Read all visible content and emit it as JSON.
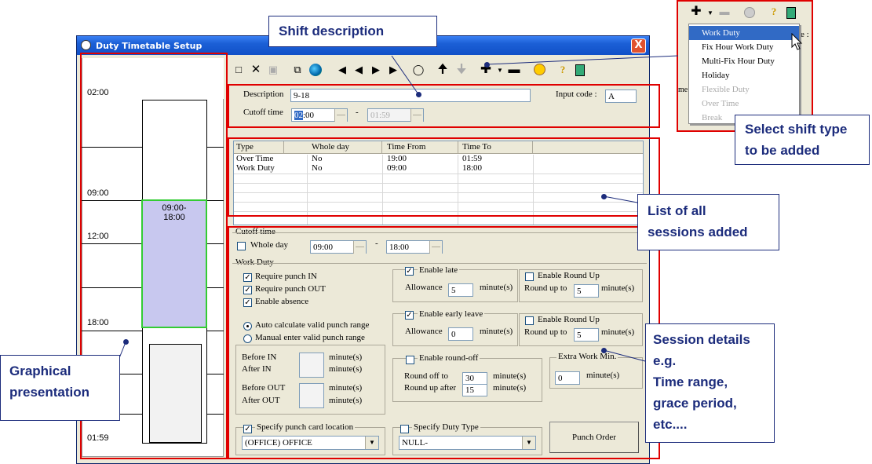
{
  "window": {
    "title": "Duty Timetable Setup",
    "close": "X"
  },
  "timeline": {
    "labels": [
      "02:00",
      "09:00",
      "12:00",
      "18:00",
      "01:59"
    ],
    "session_label": "09:00-\n18:00"
  },
  "header": {
    "description_label": "Description",
    "description_value": "9-18",
    "input_code_label": "Input code :",
    "input_code_value": "A",
    "cutoff_label": "Cutoff time",
    "cutoff_from_sel": "02",
    "cutoff_from_rest": ":00",
    "cutoff_dash": "-",
    "cutoff_to": "01:59"
  },
  "sessions": {
    "columns": [
      "Type",
      "Whole day",
      "Time From",
      "Time To"
    ],
    "rows": [
      [
        "Over Time",
        "No",
        "19:00",
        "01:59"
      ],
      [
        "Work Duty",
        "No",
        "09:00",
        "18:00"
      ]
    ]
  },
  "details": {
    "cutoff_group": "Cutoff time",
    "whole_day": "Whole day",
    "from": "09:00",
    "dash": "-",
    "to": "18:00",
    "work_duty_group": "Work Duty",
    "require_in": "Require punch IN",
    "require_out": "Require punch OUT",
    "enable_absence": "Enable absence",
    "auto_calc": "Auto calculate valid punch range",
    "manual_enter": "Manual enter valid punch range",
    "before_in": "Before IN",
    "after_in": "After IN",
    "before_out": "Before OUT",
    "after_out": "After OUT",
    "minutes_s": "minute(s)",
    "enable_late": "Enable late",
    "allowance": "Allowance",
    "late_allowance": "5",
    "enable_round_up": "Enable Round Up",
    "round_up_to": "Round up to",
    "late_round_up": "5",
    "enable_early_leave": "Enable early leave",
    "early_allowance": "0",
    "early_round_up": "5",
    "enable_round_off": "Enable round-off",
    "round_off_to": "Round off to",
    "round_off_value": "30",
    "round_up_after": "Round up after",
    "round_up_after_value": "15",
    "extra_work": "Extra Work Min.",
    "extra_work_value": "0",
    "specify_location": "Specify punch card location",
    "location_value": "(OFFICE) OFFICE",
    "specify_duty_type": "Specify Duty Type",
    "duty_type_value": "NULL-",
    "punch_order": "Punch Order"
  },
  "menu": {
    "items": [
      "Work Duty",
      "Fix Hour Work Duty",
      "Multi-Fix Hour Duty",
      "Holiday",
      "Flexible Duty",
      "Over Time",
      "Break"
    ],
    "peek_e": "e :",
    "peek_me": "me"
  },
  "callouts": {
    "shift_description": "Shift description",
    "select_shift_type": "Select shift type\nto be added",
    "list_sessions": "List of all\nsessions added",
    "graphical": "Graphical\npresentation",
    "session_details": "Session details\ne.g.\nTime range,\ngrace period,\netc...."
  },
  "colors": {
    "accent_red": "#e00000",
    "callout_blue": "#1c2c7c",
    "session_fill": "#c8c8ef",
    "session_border": "#33cc33"
  },
  "icons": [
    "new-icon",
    "delete-icon",
    "save-icon",
    "copy-icon",
    "globe-icon",
    "first-icon",
    "prev-icon",
    "next-icon",
    "last-icon",
    "find-icon",
    "move-up-icon",
    "move-down-icon",
    "add-icon",
    "remove-icon",
    "clock-icon",
    "help-icon",
    "exit-icon"
  ]
}
